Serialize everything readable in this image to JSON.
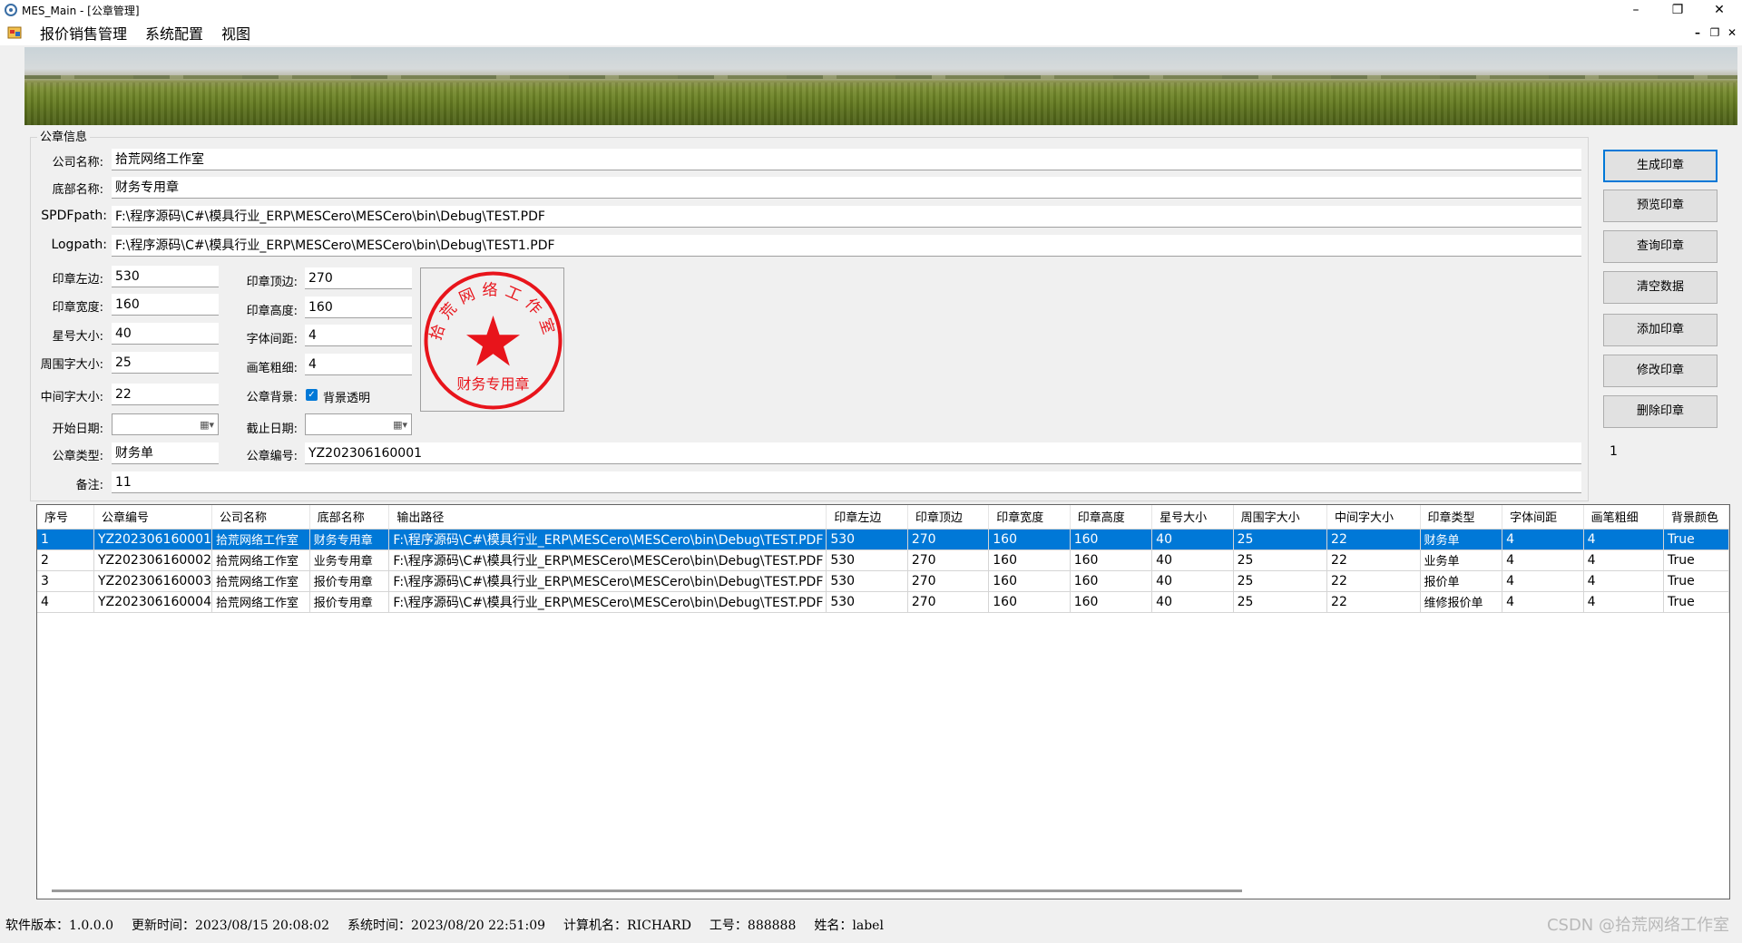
{
  "window": {
    "title": "MES_Main - [公章管理]",
    "minimize": "–",
    "maximize": "❐",
    "close": "✕"
  },
  "menu": {
    "items": [
      "报价销售管理",
      "系统配置",
      "视图"
    ],
    "mdi_minimize": "–",
    "mdi_restore": "❐",
    "mdi_close": "✕"
  },
  "form": {
    "group_title": "公章信息",
    "company_label": "公司名称:",
    "company": "拾荒网络工作室",
    "bottom_label": "底部名称:",
    "bottom": "财务专用章",
    "spdf_label": "SPDFpath:",
    "spdf": "F:\\程序源码\\C#\\模具行业_ERP\\MESCero\\MESCero\\bin\\Debug\\TEST.PDF",
    "logpath_label": "Logpath:",
    "logpath": "F:\\程序源码\\C#\\模具行业_ERP\\MESCero\\MESCero\\bin\\Debug\\TEST1.PDF",
    "left_label": "印章左边:",
    "left": "530",
    "top_label": "印章顶边:",
    "top": "270",
    "width_label": "印章宽度:",
    "width": "160",
    "height_label": "印章高度:",
    "height": "160",
    "star_label": "星号大小:",
    "star": "40",
    "spacing_label": "字体间距:",
    "spacing": "4",
    "around_label": "周围字大小:",
    "around": "25",
    "pen_label": "画笔粗细:",
    "pen": "4",
    "middle_label": "中间字大小:",
    "middle": "22",
    "bg_label": "公章背景:",
    "bg_checkbox": "背景透明",
    "start_label": "开始日期:",
    "end_label": "截止日期:",
    "type_label": "公章类型:",
    "type": "财务单",
    "number_label": "公章编号:",
    "number": "YZ202306160001",
    "note_label": "备注:",
    "note": "11",
    "count": "1"
  },
  "seal": {
    "ring_text": "拾荒网络工作室",
    "bottom_text": "财务专用章",
    "color": "#e8141b"
  },
  "buttons": [
    "生成印章",
    "预览印章",
    "查询印章",
    "清空数据",
    "添加印章",
    "修改印章",
    "删除印章"
  ],
  "grid": {
    "columns": [
      "序号",
      "公章编号",
      "公司名称",
      "底部名称",
      "输出路径",
      "印章左边",
      "印章顶边",
      "印章宽度",
      "印章高度",
      "星号大小",
      "周围字大小",
      "中间字大小",
      "印章类型",
      "字体间距",
      "画笔粗细",
      "背景颜色"
    ],
    "rows": [
      [
        "1",
        "YZ202306160001",
        "拾荒网络工作室",
        "财务专用章",
        "F:\\程序源码\\C#\\模具行业_ERP\\MESCero\\MESCero\\bin\\Debug\\TEST.PDF",
        "530",
        "270",
        "160",
        "160",
        "40",
        "25",
        "22",
        "财务单",
        "4",
        "4",
        "True"
      ],
      [
        "2",
        "YZ202306160002",
        "拾荒网络工作室",
        "业务专用章",
        "F:\\程序源码\\C#\\模具行业_ERP\\MESCero\\MESCero\\bin\\Debug\\TEST.PDF",
        "530",
        "270",
        "160",
        "160",
        "40",
        "25",
        "22",
        "业务单",
        "4",
        "4",
        "True"
      ],
      [
        "3",
        "YZ202306160003",
        "拾荒网络工作室",
        "报价专用章",
        "F:\\程序源码\\C#\\模具行业_ERP\\MESCero\\MESCero\\bin\\Debug\\TEST.PDF",
        "530",
        "270",
        "160",
        "160",
        "40",
        "25",
        "22",
        "报价单",
        "4",
        "4",
        "True"
      ],
      [
        "4",
        "YZ202306160004",
        "拾荒网络工作室",
        "报价专用章",
        "F:\\程序源码\\C#\\模具行业_ERP\\MESCero\\MESCero\\bin\\Debug\\TEST.PDF",
        "530",
        "270",
        "160",
        "160",
        "40",
        "25",
        "22",
        "维修报价单",
        "4",
        "4",
        "True"
      ]
    ],
    "selected_row": 1
  },
  "status": {
    "version": "软件版本：1.0.0.0",
    "updated": "更新时间：2023/08/15 20:08:02",
    "system_time": "系统时间：2023/08/20 22:51:09",
    "computer": "计算机名：RICHARD",
    "employee": "工号：888888",
    "name": "姓名：label"
  },
  "watermark": "CSDN @拾荒网络工作室",
  "colors": {
    "accent": "#0078d7",
    "seal_red": "#e8141b"
  }
}
